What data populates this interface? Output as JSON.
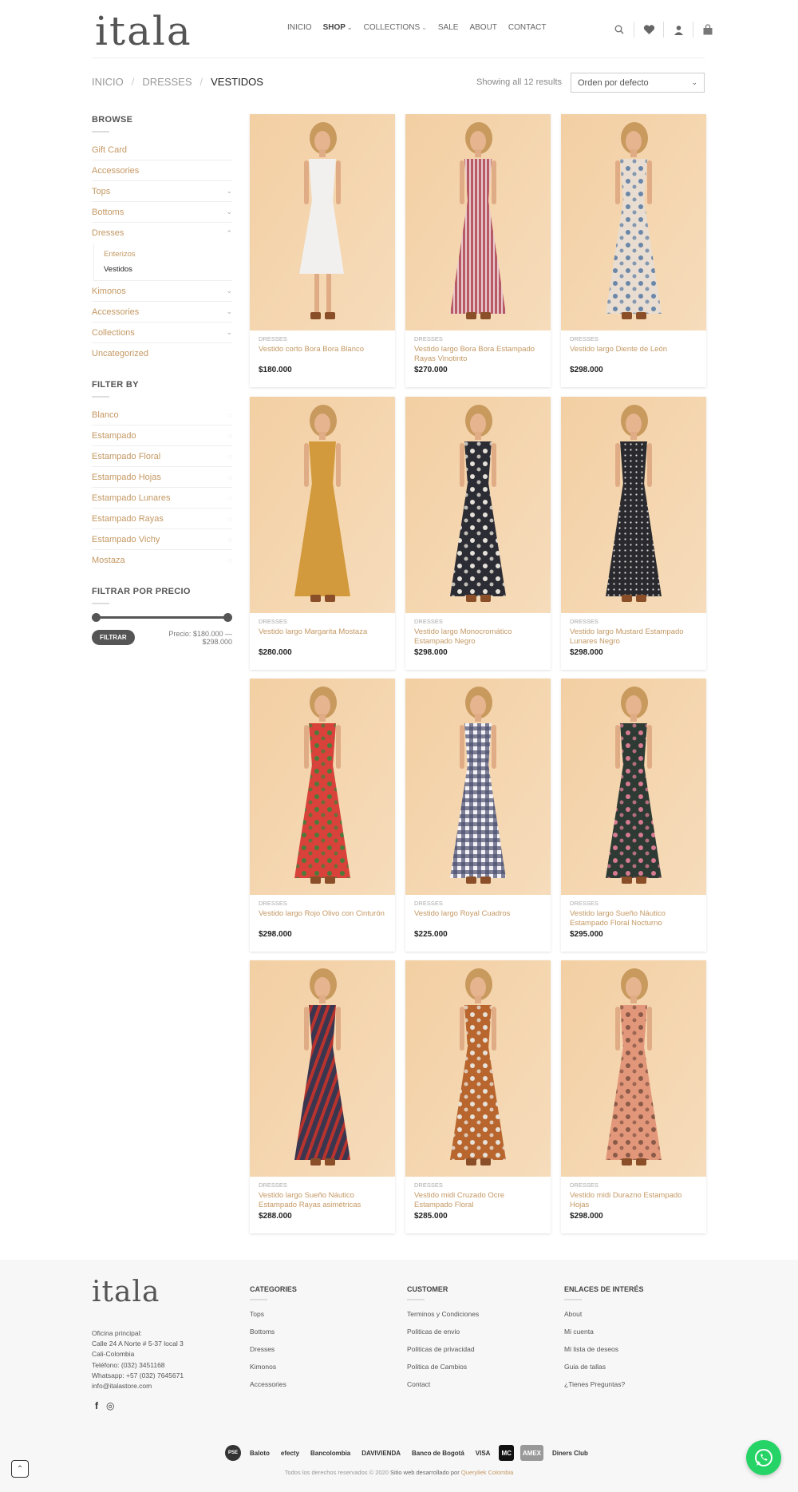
{
  "brand": {
    "logo_text": "itala",
    "accent": "#c49863"
  },
  "nav": {
    "items": [
      {
        "label": "INICIO",
        "dropdown": false
      },
      {
        "label": "SHOP",
        "dropdown": true
      },
      {
        "label": "COLLECTIONS",
        "dropdown": true
      },
      {
        "label": "SALE",
        "dropdown": false
      },
      {
        "label": "ABOUT",
        "dropdown": false
      },
      {
        "label": "CONTACT",
        "dropdown": false
      }
    ],
    "icons": [
      "search-icon",
      "heart-icon",
      "user-icon",
      "bag-icon"
    ]
  },
  "breadcrumb": {
    "items": [
      "INICIO",
      "DRESSES",
      "VESTIDOS"
    ],
    "sep": "/"
  },
  "toolbar": {
    "results": "Showing all 12 results",
    "sort_selected": "Orden por defecto"
  },
  "sidebar": {
    "browse_title": "BROWSE",
    "categories": [
      {
        "label": "Gift Card",
        "expandable": false
      },
      {
        "label": "Accessories",
        "expandable": false
      },
      {
        "label": "Tops",
        "expandable": true
      },
      {
        "label": "Bottoms",
        "expandable": true
      },
      {
        "label": "Dresses",
        "expandable": true,
        "open": true
      }
    ],
    "dresses_sub": [
      {
        "label": "Enterizos",
        "current": false
      },
      {
        "label": "Vestidos",
        "current": true
      }
    ],
    "categories_after": [
      {
        "label": "Kimonos",
        "expandable": true
      },
      {
        "label": "Accessories",
        "expandable": true
      },
      {
        "label": "Collections",
        "expandable": true
      },
      {
        "label": "Uncategorized",
        "expandable": false
      }
    ],
    "filter_title": "FILTER BY",
    "filters": [
      "Blanco",
      "Estampado",
      "Estampado Floral",
      "Estampado Hojas",
      "Estampado Lunares",
      "Estampado Rayas",
      "Estampado Vichy",
      "Mostaza"
    ],
    "price_title": "FILTRAR POR PRECIO",
    "filter_button": "FILTRAR",
    "price_label": "Precio:",
    "price_min": "$180.000",
    "price_max": "$298.000",
    "price_dash": "—"
  },
  "products": [
    {
      "category": "DRESSES",
      "name": "Vestido corto Bora Bora Blanco",
      "price": "$180.000",
      "color": "#f2f0ee",
      "pattern": "plain",
      "short": true
    },
    {
      "category": "DRESSES",
      "name": "Vestido largo Bora Bora Estampado Rayas Vinotinto",
      "price": "$270.000",
      "color": "#b85a66",
      "pattern": "stripes",
      "short": false
    },
    {
      "category": "DRESSES",
      "name": "Vestido largo Diente de León",
      "price": "$298.000",
      "color": "#e8ddd0",
      "pattern": "floral-blue",
      "short": false
    },
    {
      "category": "DRESSES",
      "name": "Vestido largo Margarita Mostaza",
      "price": "$280.000",
      "color": "#d29a3c",
      "pattern": "plain",
      "short": false
    },
    {
      "category": "DRESSES",
      "name": "Vestido largo Monocromático Estampado Negro",
      "price": "$298.000",
      "color": "#2c2c34",
      "pattern": "floral-light",
      "short": false
    },
    {
      "category": "DRESSES",
      "name": "Vestido largo Mustard Estampado Lunares Negro",
      "price": "$298.000",
      "color": "#2a2a2e",
      "pattern": "dots",
      "short": false
    },
    {
      "category": "DRESSES",
      "name": "Vestido largo Rojo Olivo con Cinturón",
      "price": "$298.000",
      "color": "#d8423a",
      "pattern": "floral-green",
      "short": false
    },
    {
      "category": "DRESSES",
      "name": "Vestido largo Royal Cuadros",
      "price": "$225.000",
      "color": "#3b3e5c",
      "pattern": "gingham",
      "short": false
    },
    {
      "category": "DRESSES",
      "name": "Vestido largo Sueño Náutico Estampado Floral Nocturno",
      "price": "$295.000",
      "color": "#2e3a34",
      "pattern": "floral-pink",
      "short": false
    },
    {
      "category": "DRESSES",
      "name": "Vestido largo Sueño Náutico Estampado Rayas asimétricas",
      "price": "$288.000",
      "color": "#3a3650",
      "pattern": "stripes-red",
      "short": false
    },
    {
      "category": "DRESSES",
      "name": "Vestido midi Cruzado Ocre Estampado Floral",
      "price": "$285.000",
      "color": "#b8652e",
      "pattern": "floral-light",
      "short": false
    },
    {
      "category": "DRESSES",
      "name": "Vestido midi Durazno Estampado Hojas",
      "price": "$298.000",
      "color": "#e3977a",
      "pattern": "leaves",
      "short": false
    }
  ],
  "footer": {
    "logo_text": "itala",
    "address": [
      "Oficina principal:",
      "Calle 24 A Norte # 5-37 local 3",
      "Cali-Colombia",
      "Teléfono: (032) 3451168",
      "Whatsapp: +57 (032) 7645671",
      "info@italastore.com"
    ],
    "social": [
      "f",
      "◎"
    ],
    "columns": [
      {
        "title": "CATEGORIES",
        "links": [
          "Tops",
          "Bottoms",
          "Dresses",
          "Kimonos",
          "Accessories"
        ]
      },
      {
        "title": "CUSTOMER",
        "links": [
          "Terminos y Condiciones",
          "Politicas de envio",
          "Politicas de privacidad",
          "Politica de Cambios",
          "Contact"
        ]
      },
      {
        "title": "ENLACES DE INTERÉS",
        "links": [
          "About",
          "Mi cuenta",
          "Mi lista de deseos",
          "Guia de tallas",
          "¿Tienes Preguntas?"
        ]
      }
    ],
    "payments": [
      "PSE",
      "Baloto",
      "efecty",
      "Bancolombia",
      "DAVIVIENDA",
      "Banco de Bogotá",
      "VISA",
      "MC",
      "AMEX",
      "Diners Club"
    ],
    "copyright_prefix": "Todos los derechos reservados © 2020",
    "copyright_mid": "Sitio web desarrollado por",
    "copyright_dev": "Queryliek Colombia"
  }
}
